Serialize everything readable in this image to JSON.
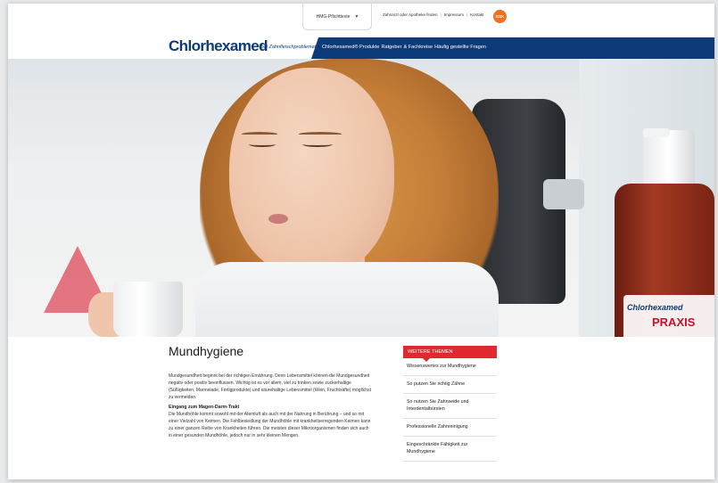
{
  "header": {
    "region_label": "HMG-Pflichttexte",
    "util_links": [
      "Zahnarzt oder Apotheke finden",
      "Impressum",
      "Kontakt"
    ],
    "company_logo": "GSK",
    "brand_logo": "Chlorhexamed",
    "brand_tagline": "– bei Zahnfleischproblemen",
    "nav": [
      "Chlorhexamed® Produkte",
      "Ratgeber",
      "& Fachkreise",
      "Häufig gestellte Fragen"
    ]
  },
  "hero": {
    "bottle_brand": "Chlorhexamed",
    "bottle_variant": "PRAXIS"
  },
  "main": {
    "title": "Mundhygiene",
    "intro": "Mundgesundheit beginnt bei der richtigen Ernährung. Denn Lebensmittel können die Mundgesundheit negativ oder positiv beeinflussen. Wichtig ist es vor allem, viel zu trinken sowie zuckerhaltige (Süßigkeiten, Marmelade, Fertigprodukte) und säurehaltige Lebensmittel (Wein, Fruchtsäfte) möglichst zu vermeiden.",
    "subheading": "Eingang zum Magen-Darm-Trakt",
    "body": "Die Mundhöhle kommt sowohl mit der Atemluft als auch mit der Nahrung in Berührung – und so mit einer Vielzahl von Keimen. Die Fehlbesiedlung der Mundhöhle mit krankheitserregenden Keimen kann zu einer ganzen Reihe von Krankheiten führen. Die meisten dieser Mikroorganismen finden sich auch in einer gesunden Mundhöhle, jedoch nur in sehr kleinen Mengen."
  },
  "aside": {
    "heading": "WEITERE THEMEN",
    "items": [
      "Wissenswertes zur Mundhygiene",
      "So putzen Sie richtig Zähne",
      "So nutzen Sie Zahnseide und Interdentalbürsten",
      "Professionelle Zahnreinigung",
      "Eingeschränkte Fähigkeit zur Mundhygiene"
    ]
  },
  "colors": {
    "brand_blue": "#0d3a78",
    "accent_red": "#e0292e",
    "gsk_orange": "#f36f21"
  }
}
